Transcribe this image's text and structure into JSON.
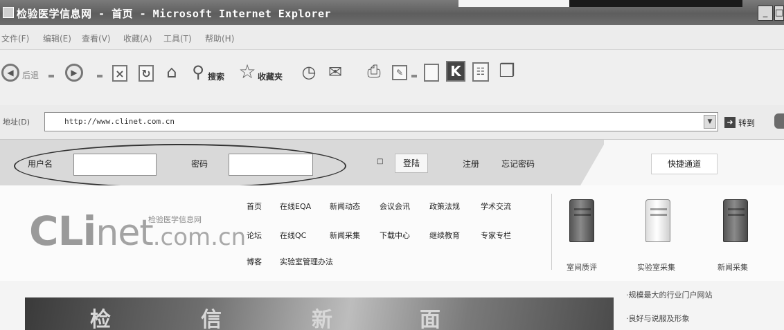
{
  "window": {
    "title": "检验医学信息网 - 首页 - Microsoft Internet Explorer",
    "minimize_glyph": "_",
    "overflow_glyph": "□"
  },
  "menu": {
    "items": [
      "文件(F)",
      "编辑(E)",
      "查看(V)",
      "收藏(A)",
      "工具(T)",
      "帮助(H)"
    ]
  },
  "toolbar": {
    "back_label": "后退",
    "search_label": "搜索",
    "favorites_label": "收藏夹"
  },
  "address": {
    "label": "地址(D)",
    "value": "http://www.clinet.com.cn",
    "go_label": "转到"
  },
  "login": {
    "username_label": "用户名",
    "password_label": "密码",
    "login_button": "登陆",
    "register_link": "注册",
    "forgot_link": "忘记密码",
    "quick_button": "快捷通道"
  },
  "site": {
    "logo_cli": "CLi",
    "logo_net": "net",
    "logo_domain": ".com.cn",
    "subtitle": "检验医学信息网",
    "nav_row1": [
      "首页",
      "在线EQA",
      "新闻动态",
      "会议会讯",
      "政策法规",
      "学术交流"
    ],
    "nav_row2": [
      "论坛",
      "在线QC",
      "新闻采集",
      "下载中心",
      "继续教育",
      "专家专栏"
    ],
    "nav_row3": [
      "博客",
      "实验室管理办法"
    ],
    "services": [
      "室间质评",
      "实验室采集",
      "新闻采集"
    ]
  },
  "banner": {
    "chars": [
      "检",
      "信",
      "新",
      "面"
    ]
  },
  "side_news": [
    "·规模最大的行业门户网站",
    "·良好与说服及形象"
  ]
}
